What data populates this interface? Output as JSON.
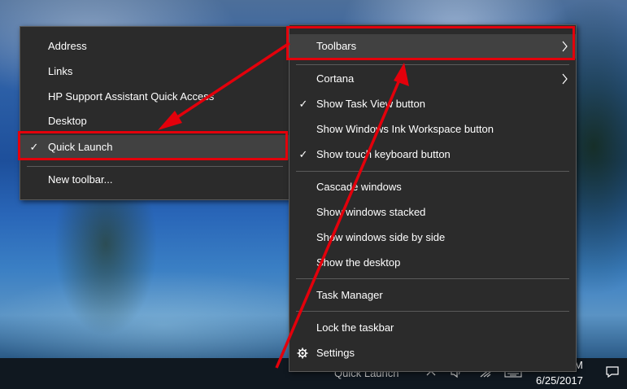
{
  "main_menu": {
    "items": [
      {
        "label": "Toolbars",
        "submenu": true
      },
      {
        "label": "Cortana",
        "submenu": true
      },
      {
        "label": "Show Task View button",
        "checked": true
      },
      {
        "label": "Show Windows Ink Workspace button"
      },
      {
        "label": "Show touch keyboard button",
        "checked": true
      },
      {
        "label": "Cascade windows"
      },
      {
        "label": "Show windows stacked"
      },
      {
        "label": "Show windows side by side"
      },
      {
        "label": "Show the desktop"
      },
      {
        "label": "Task Manager"
      },
      {
        "label": "Lock the taskbar"
      },
      {
        "label": "Settings",
        "icon": "gear-icon"
      }
    ]
  },
  "toolbars_submenu": {
    "items": [
      {
        "label": "Address"
      },
      {
        "label": "Links"
      },
      {
        "label": "HP Support Assistant Quick Access"
      },
      {
        "label": "Desktop"
      },
      {
        "label": "Quick Launch",
        "checked": true
      },
      {
        "label": "New toolbar..."
      }
    ]
  },
  "taskbar": {
    "quick_launch_label": "Quick Launch",
    "date": "6/25/2017",
    "time_partial": "M"
  },
  "glyphs": {
    "check": "✓",
    "chevron": "›"
  },
  "colors": {
    "menu_bg": "#2b2b2b",
    "annotation_red": "#e3000b",
    "taskbar_bg": "#101820"
  }
}
